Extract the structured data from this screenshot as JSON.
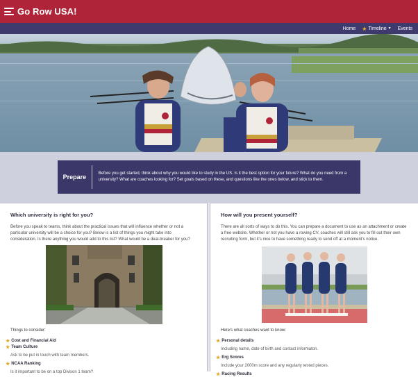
{
  "header": {
    "brand": "Go Row USA!"
  },
  "nav": {
    "items": [
      {
        "label": "Home"
      },
      {
        "label": "Timeline"
      },
      {
        "label": "Events"
      }
    ]
  },
  "colors": {
    "accent_red": "#b0243a",
    "nav_purple": "#3f3a6e",
    "band_purple": "#3b3769",
    "star_gold": "#f3b426"
  },
  "prepare": {
    "title": "Prepare",
    "text": "Before you get started, think about why you would like to study in the US. Is it the best option for your future? What do you need from a university? What are coaches looking for? Set goals based on these, and questions like the ones below, and stick to them."
  },
  "left": {
    "heading": "Which university is right for you?",
    "intro": "Before you speak to teams, think about the practical issues that will influence whether or not a particular university will be a choice for you? Below is a list of things you might take into consideration. Is there anything you would add to this list? What would be a deal-breaker for you?",
    "list_title": "Things to consider:",
    "items": [
      {
        "label": "Cost and Financial Aid",
        "detail": ""
      },
      {
        "label": "Team Culture",
        "detail": "Ask to be put in touch with team members."
      },
      {
        "label": "NCAA Ranking",
        "detail": "Is it important to be on a top Divison 1 team?"
      }
    ]
  },
  "right": {
    "heading": "How will you present yourself?",
    "intro": "There are all sorts of ways to do this. You can prepare a document to use as an attachment or create a free website. Whether or not you have a rowing CV, coaches will still ask you to fill out their own recruiting form, but it's nice to have something ready to send off at a moment's notice.",
    "list_title": "Here's what coaches want to know:",
    "items": [
      {
        "label": "Personal details",
        "detail": "Including name, date of birth and contact informaton."
      },
      {
        "label": "Erg Scores",
        "detail": "Include your 2000m score and any regularly tested pieces."
      },
      {
        "label": "Racing Results",
        "detail": ""
      }
    ]
  }
}
